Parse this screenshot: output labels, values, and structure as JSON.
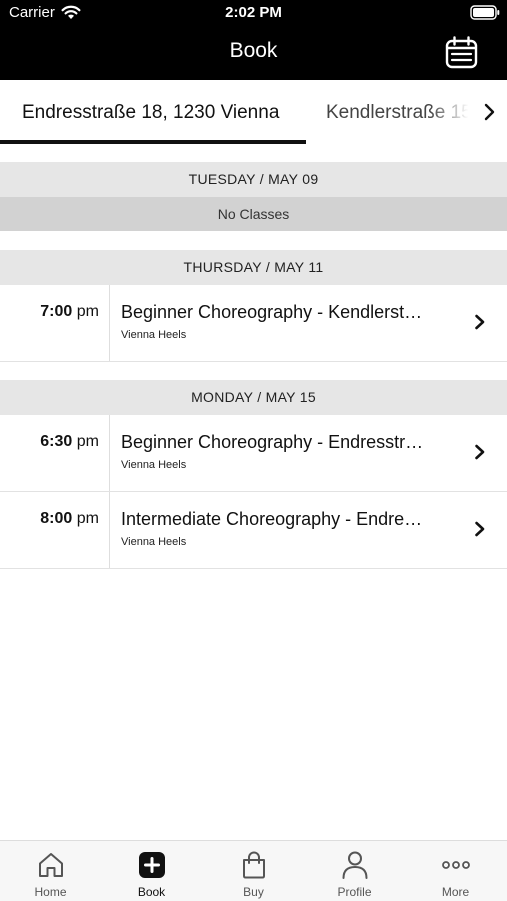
{
  "status_bar": {
    "carrier": "Carrier",
    "time": "2:02 PM",
    "icons": [
      "wifi-icon",
      "battery-icon"
    ]
  },
  "header": {
    "title": "Book",
    "right_icon": "calendar-list-icon"
  },
  "location_tabs": [
    {
      "label": "Endresstraße 18, 1230 Vienna",
      "active": true
    },
    {
      "label": "Kendlerstraße 15",
      "active": false
    }
  ],
  "schedule": {
    "days": [
      {
        "header": "TUESDAY / MAY 09",
        "empty_text": "No Classes",
        "classes": []
      },
      {
        "header": "THURSDAY / MAY 11",
        "classes": [
          {
            "time": "7:00",
            "ampm": "pm",
            "title": "Beginner Choreography - Kendlerst…",
            "studio": "Vienna Heels"
          }
        ]
      },
      {
        "header": "MONDAY / MAY 15",
        "classes": [
          {
            "time": "6:30",
            "ampm": "pm",
            "title": "Beginner Choreography - Endresstr…",
            "studio": "Vienna Heels"
          },
          {
            "time": "8:00",
            "ampm": "pm",
            "title": "Intermediate Choreography - Endre…",
            "studio": "Vienna Heels"
          }
        ]
      }
    ]
  },
  "tab_bar": {
    "items": [
      {
        "label": "Home",
        "icon": "home-icon",
        "active": false
      },
      {
        "label": "Book",
        "icon": "plus-square-icon",
        "active": true
      },
      {
        "label": "Buy",
        "icon": "shopping-bag-icon",
        "active": false
      },
      {
        "label": "Profile",
        "icon": "person-icon",
        "active": false
      },
      {
        "label": "More",
        "icon": "ellipsis-icon",
        "active": false
      }
    ]
  },
  "colors": {
    "header_bg": "#000000",
    "day_header_bg": "#e6e6e6",
    "empty_row_bg": "#d2d2d2",
    "accent": "#111111"
  }
}
